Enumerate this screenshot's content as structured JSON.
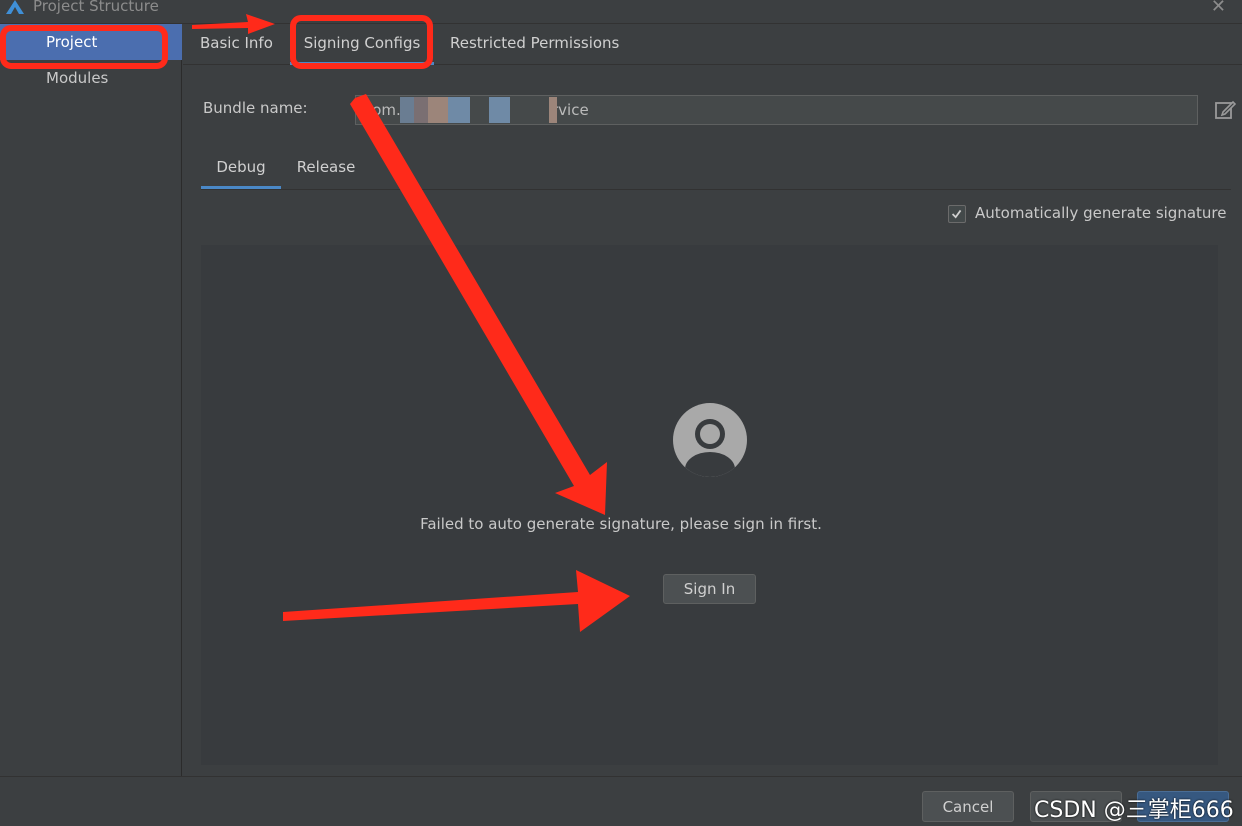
{
  "window": {
    "title": "Project Structure",
    "close_glyph": "✕"
  },
  "sidebar": {
    "items": [
      {
        "label": "Project"
      },
      {
        "label": "Modules"
      }
    ]
  },
  "tabs": [
    {
      "label": "Basic Info"
    },
    {
      "label": "Signing Configs"
    },
    {
      "label": "Restricted Permissions"
    }
  ],
  "bundle": {
    "label": "Bundle name:",
    "value_start": "com.h",
    "value_end": "rvice"
  },
  "subtabs": [
    {
      "label": "Debug"
    },
    {
      "label": "Release"
    }
  ],
  "auto_signature": {
    "label": "Automatically generate signature",
    "checked": true
  },
  "panel": {
    "message": "Failed to auto generate signature, please sign in first.",
    "signin_label": "Sign In"
  },
  "footer": {
    "cancel_label": "Cancel"
  },
  "watermark": "CSDN @三掌柜666",
  "colors": {
    "accent": "#4a88c7",
    "selection": "#4b6eaf",
    "annotation": "#ff2a1a"
  }
}
